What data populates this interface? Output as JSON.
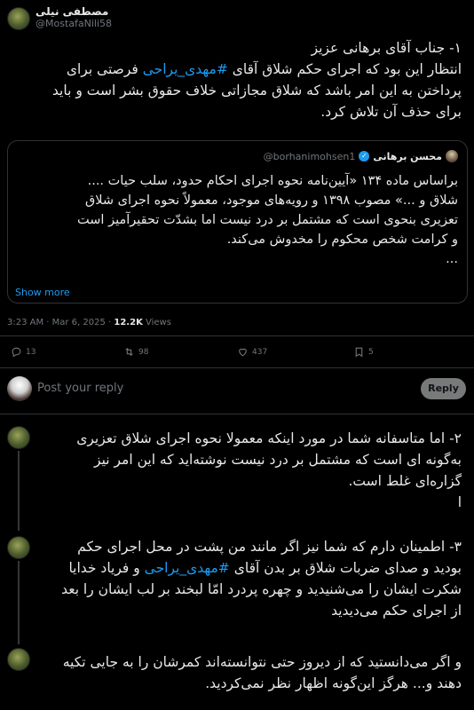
{
  "tweet": {
    "author_name": "مصطفی نیلی",
    "author_handle": "@MostafaNili58",
    "lines": [
      "۱- جناب آقای برهانی عزیز",
      "انتظار  این بود که اجرای حکم شلاق آقای #مهدی_یراحی  فرصتی برای",
      "پرداختن به این امر باشد که شلاق مجازاتی خلاف حقوق بشر است و باید",
      "برای حذف آن تلاش کرد."
    ],
    "hashtag": "#مهدی_یراحی"
  },
  "quote": {
    "name": "محسن برهانی",
    "handle": "@borhanimohsen1",
    "lines": [
      "براساس ماده ۱۳۴ «آیین‌نامه نحوه اجرای احکام حدود، سلب حیات ....",
      "شلاق و ...» مصوب ۱۳۹۸ و رویه‌های موجود، معمولاً نحوه اجرای شلاق",
      "تعزیری بنحوی است که مشتمل بر درد نیست اما بشدّت تحقیرآمیز است",
      "و کرامت شخص محکوم را مخدوش می‌کند.",
      "..."
    ],
    "show_more": "Show more"
  },
  "meta": {
    "time": "3:23 AM · Mar 6, 2025 · ",
    "views_count": "12.2K",
    "views_label": " Views"
  },
  "actions": {
    "replies": "13",
    "retweets": "98",
    "likes": "437",
    "bookmarks": "5"
  },
  "reply_box": {
    "placeholder": "Post your reply",
    "button": "Reply"
  },
  "thread": [
    {
      "lines": [
        "۲- اما متاسفانه شما در مورد اینکه  معمولا نحوه اجرای شلاق تعزیری",
        "به‌گونه ای است که مشتمل بر درد نیست نوشته‌اید که این امر نیز",
        "گزاره‌ای غلط است.",
        "ا"
      ]
    },
    {
      "lines": [
        "۳- اطمینان دارم که شما نیز اگر مانند من پشت در محل اجرای حکم",
        "بودید و صدای ضربات شلاق بر بدن آقای #مهدی_یراحی و فریاد خدایا",
        "شکرت ایشان را می‌شنیدید و چهره پردرد امّا لبخند بر لب ایشان را بعد",
        "از اجرای حکم می‌دیدید"
      ]
    },
    {
      "lines": [
        "و اگر می‌دانستید که از دیروز حتی نتوانسته‌اند کمرشان را به جایی تکیه",
        "دهند و... هرگز این‌گونه  اظهار نظر نمی‌کردید."
      ]
    }
  ],
  "colors": {
    "background": "#000000",
    "text": "#e7e9ea",
    "muted": "#71767b",
    "accent": "#1d9bf0",
    "border": "#2f3336"
  }
}
